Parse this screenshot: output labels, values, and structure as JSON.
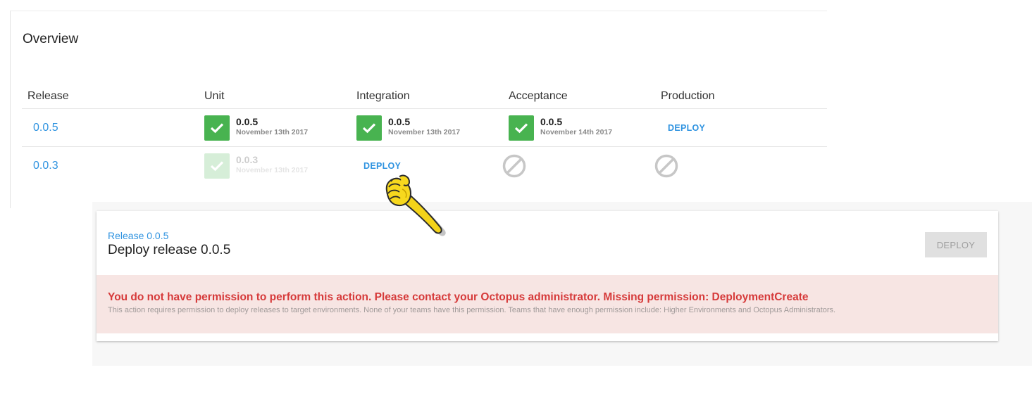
{
  "overview": {
    "title": "Overview",
    "columns": [
      "Release",
      "Unit",
      "Integration",
      "Acceptance",
      "Production"
    ],
    "rows": [
      {
        "release": "0.0.5",
        "unit": {
          "version": "0.0.5",
          "date": "November 13th 2017",
          "status": "success"
        },
        "integration": {
          "version": "0.0.5",
          "date": "November 13th 2017",
          "status": "success"
        },
        "acceptance": {
          "version": "0.0.5",
          "date": "November 14th 2017",
          "status": "success"
        },
        "production": {
          "action": "DEPLOY"
        }
      },
      {
        "release": "0.0.3",
        "unit": {
          "version": "0.0.3",
          "date": "November 13th 2017",
          "status": "superseded"
        },
        "integration": {
          "action": "DEPLOY"
        },
        "acceptance": {
          "status": "not-allowed"
        },
        "production": {
          "status": "not-allowed"
        }
      }
    ]
  },
  "deploy_panel": {
    "breadcrumb": "Release 0.0.5",
    "title": "Deploy release 0.0.5",
    "deploy_button": "DEPLOY",
    "error": {
      "message": "You do not have permission to perform this action. Please contact your Octopus administrator. Missing permission: DeploymentCreate",
      "detail": "This action requires permission to deploy releases to target environments. None of your teams have this permission. Teams that have enough permission include: Higher Environments and Octopus Administrators."
    }
  },
  "icons": {
    "success": "check-icon",
    "not_allowed": "not-allowed-icon",
    "cursor": "pointing-hand-icon"
  },
  "colors": {
    "link": "#2f93e0",
    "success": "#48b350",
    "error_text": "#d63a3a",
    "error_bg": "#f7e5e3",
    "disabled_button": "#e0e0e0"
  }
}
